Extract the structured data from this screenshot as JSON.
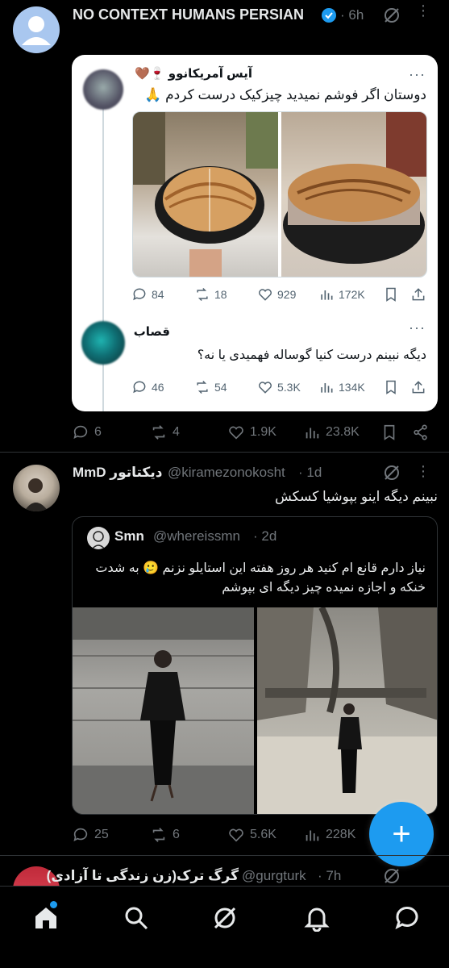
{
  "post1": {
    "author": "NO CONTEXT HUMANS PERSIAN",
    "time": "· 6h",
    "quote1": {
      "name": "آیس آمریکانوو 🍷🤎",
      "text": "دوستان اگر فوشم نمیدید چیزکیک درست کردم 🙏",
      "replies": "84",
      "reposts": "18",
      "likes": "929",
      "views": "172K"
    },
    "quote2": {
      "name": "قصاب",
      "text": "دیگه نبینم درست کنیا گوساله فهمیدی یا نه؟",
      "replies": "46",
      "reposts": "54",
      "likes": "5.3K",
      "views": "134K"
    },
    "replies": "6",
    "reposts": "4",
    "likes": "1.9K",
    "views": "23.8K"
  },
  "post2": {
    "name": "MmD دیکتاتور",
    "handle": "@kiramezonokosht",
    "time": "· 1d",
    "text": "نبینم دیگه اینو بپوشیا کسکش",
    "quoted": {
      "name": "Smn",
      "handle": "@whereissmn",
      "time": "· 2d",
      "text": "نیاز دارم قانع ام کنید هر روز هفته این استایلو نزنم 🥲 به شدت خنکه و اجازه نمیده چیز دیگه ای بپوشم"
    },
    "replies": "25",
    "reposts": "6",
    "likes": "5.6K",
    "views": "228K"
  },
  "post3": {
    "name": "گرگ ترک(زن زندگی تا آزادی)",
    "handle": "@gurgturk",
    "time": "· 7h"
  },
  "fab_label": "+",
  "colors": {
    "accent": "#1d9bf0",
    "verified": "#1d9bf0",
    "background": "#000000"
  }
}
